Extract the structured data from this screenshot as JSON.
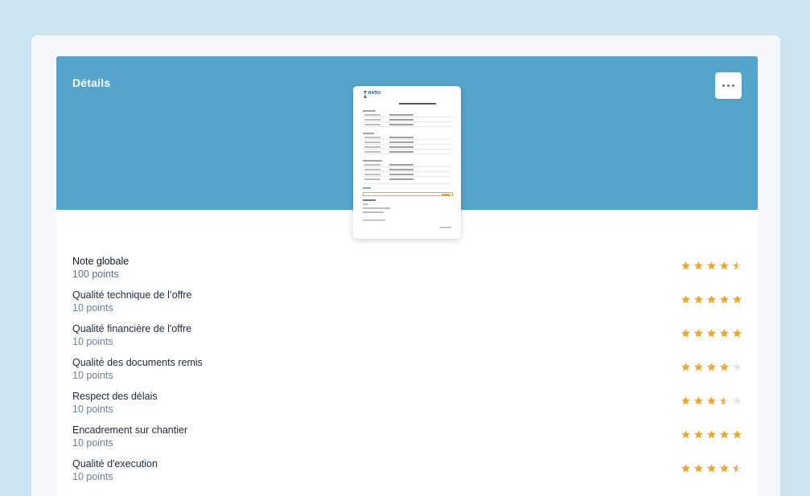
{
  "colors": {
    "background": "#cce5f1",
    "banner": "#55a4cb",
    "star_filled": "#f5a623",
    "star_empty": "#e5e7eb"
  },
  "header": {
    "title": "Détails",
    "more_icon": "ellipsis-icon"
  },
  "document": {
    "logo_icon": "company-logo",
    "logo_text": "RATIO"
  },
  "ratings": [
    {
      "label": "Note globale",
      "points": "100 points",
      "stars": 4.5,
      "main": true
    },
    {
      "label": "Qualité technique de l’offre",
      "points": "10 points",
      "stars": 5
    },
    {
      "label": "Qualité financière de l'offre",
      "points": "10 points",
      "stars": 5
    },
    {
      "label": "Qualité des documents remis",
      "points": "10 points",
      "stars": 4
    },
    {
      "label": "Respect des délais",
      "points": "10 points",
      "stars": 3.5
    },
    {
      "label": "Encadrement sur chantier",
      "points": "10 points",
      "stars": 5
    },
    {
      "label": "Qualité d'execution",
      "points": "10 points",
      "stars": 4.5
    }
  ]
}
